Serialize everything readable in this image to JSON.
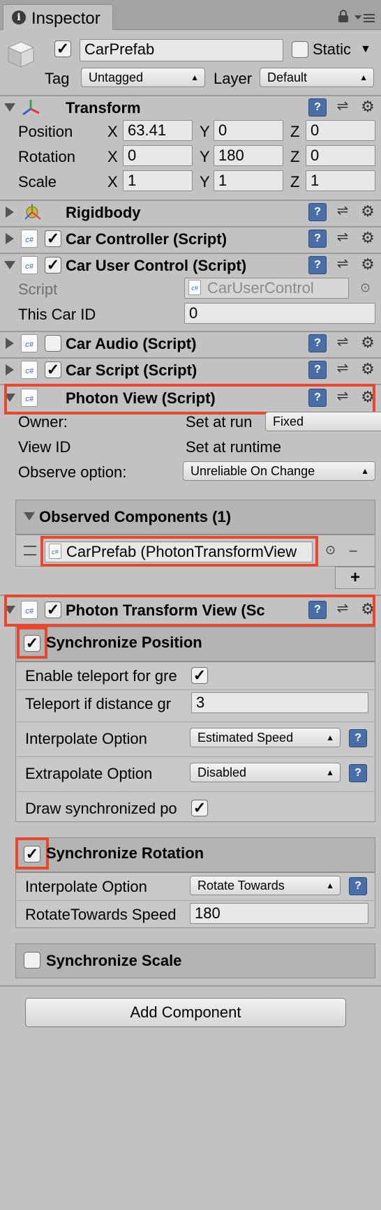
{
  "window": {
    "tab_label": "Inspector",
    "info_icon": "info-icon",
    "lock_icon": "lock-icon",
    "menu_icon": "menu-icon"
  },
  "header": {
    "object_name": "CarPrefab",
    "static_label": "Static",
    "tag_label": "Tag",
    "tag_value": "Untagged",
    "layer_label": "Layer",
    "layer_value": "Default"
  },
  "transform": {
    "title": "Transform",
    "position_label": "Position",
    "rotation_label": "Rotation",
    "scale_label": "Scale",
    "axis_x": "X",
    "axis_y": "Y",
    "axis_z": "Z",
    "position": {
      "x": "63.41",
      "y": "0",
      "z": "0"
    },
    "rotation": {
      "x": "0",
      "y": "180",
      "z": "0"
    },
    "scale": {
      "x": "1",
      "y": "1",
      "z": "1"
    }
  },
  "components": {
    "rigidbody": "Rigidbody",
    "car_controller": "Car Controller (Script)",
    "car_user_control": "Car User Control (Script)",
    "car_audio": "Car Audio (Script)",
    "car_script": "Car Script (Script)",
    "photon_view": "Photon View (Script)",
    "photon_transform_view": "Photon Transform View (Sc"
  },
  "car_user_control": {
    "script_label": "Script",
    "script_value": "CarUserControl",
    "car_id_label": "This Car ID",
    "car_id_value": "0"
  },
  "photon_view": {
    "owner_label": "Owner:",
    "owner_value": "Set at run",
    "owner_dropdown": "Fixed",
    "view_id_label": "View ID",
    "view_id_value": "Set at runtime",
    "observe_label": "Observe option:",
    "observe_value": "Unreliable On Change",
    "observed_title": "Observed Components (1)",
    "observed_item": "CarPrefab (PhotonTransformView",
    "remove_label": "–",
    "add_label": "+"
  },
  "ptv": {
    "sync_position": "Synchronize Position",
    "enable_teleport_label": "Enable teleport for gre",
    "teleport_distance_label": "Teleport if distance gr",
    "teleport_distance_value": "3",
    "interpolate_label": "Interpolate Option",
    "interpolate_value": "Estimated Speed",
    "extrapolate_label": "Extrapolate Option",
    "extrapolate_value": "Disabled",
    "draw_sync_label": "Draw synchronized po",
    "sync_rotation": "Synchronize Rotation",
    "rot_interpolate_label": "Interpolate Option",
    "rot_interpolate_value": "Rotate Towards",
    "rotate_speed_label": "RotateTowards Speed",
    "rotate_speed_value": "180",
    "sync_scale": "Synchronize Scale"
  },
  "footer": {
    "add_component": "Add Component"
  },
  "colors": {
    "highlight": "#e8472f",
    "background": "#c2c2c2",
    "help_icon": "#4a6ea8"
  }
}
